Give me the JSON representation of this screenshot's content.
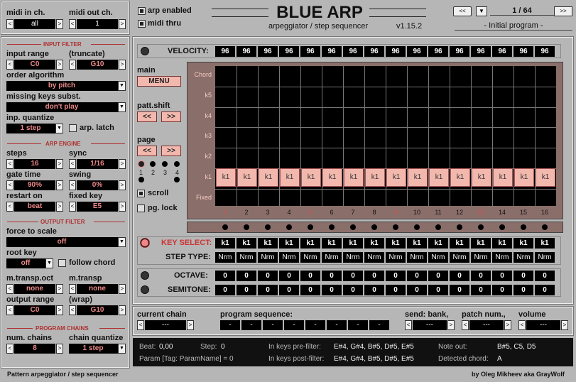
{
  "midi": {
    "in_label": "midi in ch.",
    "in_value": "all",
    "out_label": "midi out ch.",
    "out_value": "1"
  },
  "toggles": {
    "arp_enabled": "arp enabled",
    "midi_thru": "midi thru"
  },
  "header": {
    "title": "BLUE ARP",
    "subtitle": "arpeggiator / step sequencer",
    "version": "v1.15.2"
  },
  "program": {
    "position": "1 / 64",
    "name": "- Initial program -"
  },
  "input_filter": {
    "heading": "INPUT FILTER",
    "input_range_label": "input range",
    "truncate_label": "(truncate)",
    "range_low": "C0",
    "range_high": "G10",
    "order_label": "order algorithm",
    "order_value": "by pitch",
    "missing_label": "missing keys subst.",
    "missing_value": "don't play",
    "quantize_label": "inp. quantize",
    "quantize_value": "1 step",
    "latch_label": "arp. latch"
  },
  "arp_engine": {
    "heading": "ARP ENGINE",
    "steps_label": "steps",
    "steps_value": "16",
    "sync_label": "sync",
    "sync_value": "1/16",
    "gate_label": "gate time",
    "gate_value": "90%",
    "swing_label": "swing",
    "swing_value": "0%",
    "restart_label": "restart on",
    "restart_value": "beat",
    "fixed_label": "fixed key",
    "fixed_value": "E5"
  },
  "output_filter": {
    "heading": "OUTPUT FILTER",
    "scale_label": "force to scale",
    "scale_value": "off",
    "root_label": "root key",
    "root_value": "off",
    "follow_label": "follow chord",
    "mtransp_oct_label": "m.transp.oct",
    "mtransp_oct_value": "none",
    "mtransp_label": "m.transp",
    "mtransp_value": "none",
    "out_range_label": "output range",
    "wrap_label": "(wrap)",
    "out_low": "C0",
    "out_high": "G10"
  },
  "program_chains": {
    "heading": "PROGRAM CHAINS",
    "num_label": "num. chains",
    "num_value": "8",
    "quant_label": "chain quantize",
    "quant_value": "1 step"
  },
  "sequencer": {
    "velocity_label": "VELOCITY:",
    "velocity": [
      "96",
      "96",
      "96",
      "96",
      "96",
      "96",
      "96",
      "96",
      "96",
      "96",
      "96",
      "96",
      "96",
      "96",
      "96",
      "96"
    ],
    "main_label": "main",
    "menu_label": "MENU",
    "patt_shift_label": "patt.shift",
    "page_label": "page",
    "page_nums": [
      "1",
      "2",
      "3",
      "4"
    ],
    "scroll_label": "scroll",
    "pg_lock_label": "pg. lock",
    "row_labels": [
      "Chord",
      "k5",
      "k4",
      "k3",
      "k2",
      "k1",
      "Fixed"
    ],
    "notes": [
      "k1",
      "k1",
      "k1",
      "k1",
      "k1",
      "k1",
      "k1",
      "k1",
      "k1",
      "k1",
      "k1",
      "k1",
      "k1",
      "k1",
      "k1",
      "k1"
    ],
    "step_nums": [
      "1",
      "2",
      "3",
      "4",
      "5",
      "6",
      "7",
      "8",
      "9",
      "10",
      "11",
      "12",
      "13",
      "14",
      "15",
      "16"
    ],
    "key_select_label": "KEY SELECT:",
    "key_select": [
      "k1",
      "k1",
      "k1",
      "k1",
      "k1",
      "k1",
      "k1",
      "k1",
      "k1",
      "k1",
      "k1",
      "k1",
      "k1",
      "k1",
      "k1",
      "k1"
    ],
    "step_type_label": "STEP TYPE:",
    "step_type": [
      "Nrm",
      "Nrm",
      "Nrm",
      "Nrm",
      "Nrm",
      "Nrm",
      "Nrm",
      "Nrm",
      "Nrm",
      "Nrm",
      "Nrm",
      "Nrm",
      "Nrm",
      "Nrm",
      "Nrm",
      "Nrm"
    ],
    "octave_label": "OCTAVE:",
    "octave": [
      "0",
      "0",
      "0",
      "0",
      "0",
      "0",
      "0",
      "0",
      "0",
      "0",
      "0",
      "0",
      "0",
      "0",
      "0",
      "0"
    ],
    "semitone_label": "SEMITONE:",
    "semitone": [
      "0",
      "0",
      "0",
      "0",
      "0",
      "0",
      "0",
      "0",
      "0",
      "0",
      "0",
      "0",
      "0",
      "0",
      "0",
      "0"
    ]
  },
  "chain": {
    "current_label": "current chain",
    "current_value": "---",
    "seq_label": "program sequence:",
    "seq": [
      "-",
      "-",
      "-",
      "-",
      "-",
      "-",
      "-",
      "-"
    ],
    "bank_label": "send: bank,",
    "bank_value": "---",
    "patch_label": "patch num.,",
    "patch_value": "---",
    "volume_label": "volume",
    "volume_value": "---"
  },
  "status": {
    "beat_label": "Beat:",
    "beat": "0,00",
    "step_label": "Step:",
    "step": "0",
    "param": "Param [Tag: ParamName] = 0",
    "prefilter_label": "In keys pre-filter:",
    "prefilter": "E#4, G#4, B#5, D#5, E#5",
    "postfilter_label": "In keys post-filter:",
    "postfilter": "E#4, G#4, B#5, D#5, E#5",
    "noteout_label": "Note out:",
    "noteout": "B#5, C5, D5",
    "chord_label": "Detected chord:",
    "chord": "A"
  },
  "footer": {
    "left": "Pattern arpeggiator / step sequencer",
    "right": "by Oleg Mikheev aka GrayWolf"
  }
}
